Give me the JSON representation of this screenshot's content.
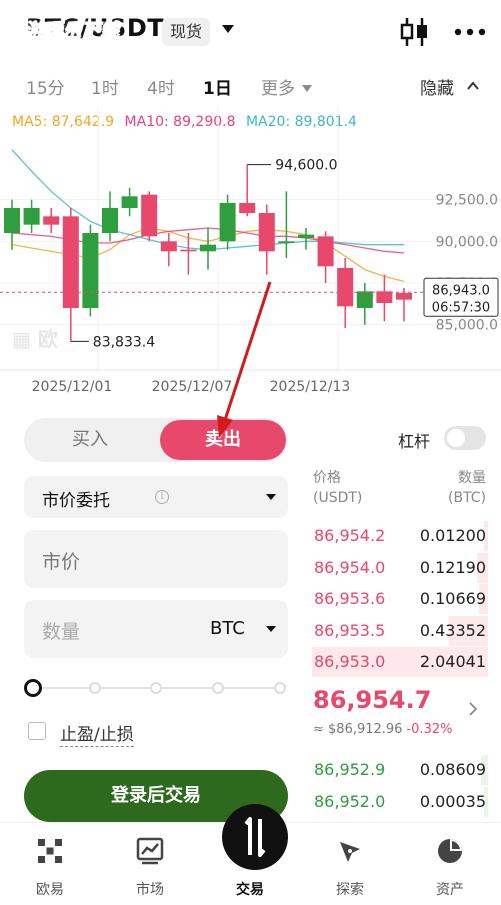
{
  "header": {
    "pair": "BTC/USDT",
    "market_badge": "现货",
    "watermark_line1": "游暖乐下载",
    "watermark_line2": "小编亲测"
  },
  "timeframes": [
    {
      "label": "15分",
      "active": false
    },
    {
      "label": "1时",
      "active": false
    },
    {
      "label": "4时",
      "active": false
    },
    {
      "label": "1日",
      "active": true
    },
    {
      "label": "更多",
      "active": false
    }
  ],
  "hide_label": "隐藏",
  "ma": {
    "ma5": "MA5: 87,642.9",
    "ma10": "MA10: 89,290.8",
    "ma20": "MA20: 89,801.4"
  },
  "chart_data": {
    "type": "candlestick",
    "x_labels": [
      "2025/12/01",
      "2025/12/07",
      "2025/12/13"
    ],
    "y_ticks": [
      "92,500.0",
      "90,000.0",
      "87,500.0",
      "85,000.0"
    ],
    "y_tick_values": [
      92500,
      90000,
      87500,
      85000
    ],
    "ylim": [
      83000,
      96500
    ],
    "high_annotation": "94,600.0",
    "low_annotation": "83,833.4",
    "current_price_label": "86,943.0",
    "countdown_label": "06:57:30",
    "candles": [
      {
        "o": 90500,
        "c": 92000,
        "h": 92500,
        "l": 89500
      },
      {
        "o": 91000,
        "c": 92000,
        "h": 92500,
        "l": 90500
      },
      {
        "o": 91500,
        "c": 91000,
        "h": 92000,
        "l": 90500
      },
      {
        "o": 91500,
        "c": 86000,
        "h": 92000,
        "l": 84000
      },
      {
        "o": 86000,
        "c": 90500,
        "h": 91000,
        "l": 85500
      },
      {
        "o": 90500,
        "c": 92000,
        "h": 93000,
        "l": 90000
      },
      {
        "o": 92000,
        "c": 92700,
        "h": 93200,
        "l": 91500
      },
      {
        "o": 92800,
        "c": 90300,
        "h": 93000,
        "l": 90000
      },
      {
        "o": 90000,
        "c": 89400,
        "h": 90500,
        "l": 88500
      },
      {
        "o": 89500,
        "c": 89400,
        "h": 90500,
        "l": 88000
      },
      {
        "o": 89400,
        "c": 89800,
        "h": 90800,
        "l": 88300
      },
      {
        "o": 90000,
        "c": 92300,
        "h": 92800,
        "l": 89500
      },
      {
        "o": 92300,
        "c": 91700,
        "h": 94600,
        "l": 91500
      },
      {
        "o": 91700,
        "c": 89400,
        "h": 92200,
        "l": 88000
      },
      {
        "o": 89900,
        "c": 90000,
        "h": 93000,
        "l": 89000
      },
      {
        "o": 90200,
        "c": 90400,
        "h": 90800,
        "l": 89500
      },
      {
        "o": 90300,
        "c": 88500,
        "h": 90600,
        "l": 87500
      },
      {
        "o": 88400,
        "c": 86100,
        "h": 89000,
        "l": 84800
      },
      {
        "o": 86000,
        "c": 87000,
        "h": 87500,
        "l": 85000
      },
      {
        "o": 87000,
        "c": 86300,
        "h": 88000,
        "l": 85200
      },
      {
        "o": 86900,
        "c": 86500,
        "h": 87200,
        "l": 85200
      }
    ],
    "ma_series": [
      {
        "name": "MA5",
        "color": "#f5a623",
        "values": [
          89800,
          89600,
          89400,
          89200,
          89000,
          89500,
          90400,
          90800,
          90600,
          90200,
          90000,
          90300,
          90600,
          90700,
          90600,
          90400,
          89900,
          89100,
          88300,
          87900,
          87600
        ]
      },
      {
        "name": "MA10",
        "color": "#e8437b",
        "values": [
          90500,
          90400,
          90300,
          90100,
          89900,
          89900,
          90100,
          90400,
          90600,
          90700,
          90800,
          90700,
          90500,
          90300,
          90300,
          90200,
          90000,
          89800,
          89600,
          89400,
          89300
        ]
      },
      {
        "name": "MA20",
        "color": "#3cb7c7",
        "values": [
          95500,
          94200,
          93000,
          92000,
          91200,
          90700,
          90400,
          90100,
          89800,
          89600,
          89500,
          89600,
          89700,
          89800,
          89900,
          90000,
          90000,
          89900,
          89800,
          89800,
          89800
        ]
      }
    ],
    "colors": {
      "up": "#2e9e3e",
      "down": "#e9486d"
    }
  },
  "order": {
    "buy_label": "买入",
    "sell_label": "卖出",
    "leverage_label": "杠杆",
    "order_type": "市价委托",
    "info_glyph": "i",
    "price_placeholder": "市价",
    "qty_placeholder": "数量",
    "qty_unit": "BTC",
    "tpsl_label": "止盈/止损",
    "login_button": "登录后交易"
  },
  "orderbook": {
    "price_header": "价格\n(USDT)",
    "qty_header": "数量\n(BTC)",
    "asks": [
      {
        "price": "86,954.2",
        "qty": "0.01200",
        "depth": 0.02
      },
      {
        "price": "86,954.0",
        "qty": "0.12190",
        "depth": 0.06
      },
      {
        "price": "86,953.6",
        "qty": "0.10669",
        "depth": 0.05
      },
      {
        "price": "86,953.5",
        "qty": "0.43352",
        "depth": 0.22
      },
      {
        "price": "86,953.0",
        "qty": "2.04041",
        "depth": 1.0
      }
    ],
    "last_price": "86,954.7",
    "index_price": "≈ $86,912.96",
    "change": "-0.32%",
    "bids": [
      {
        "price": "86,952.9",
        "qty": "0.08609",
        "depth": 0.04
      },
      {
        "price": "86,952.0",
        "qty": "0.00035",
        "depth": 0.01
      }
    ]
  },
  "nav": [
    {
      "label": "欧易",
      "active": false
    },
    {
      "label": "市场",
      "active": false
    },
    {
      "label": "交易",
      "active": true
    },
    {
      "label": "探索",
      "active": false
    },
    {
      "label": "资产",
      "active": false
    }
  ]
}
